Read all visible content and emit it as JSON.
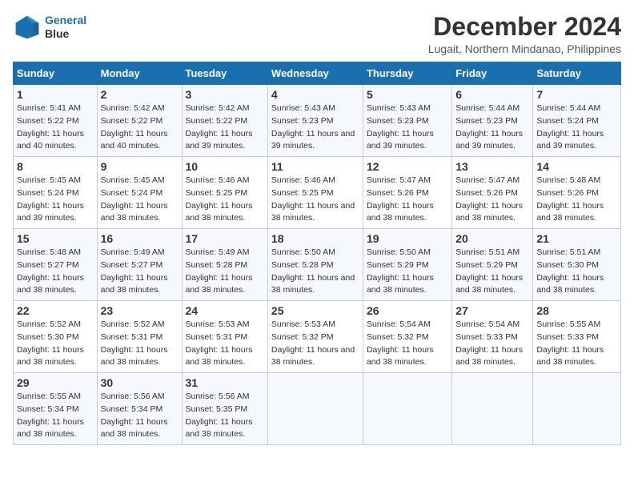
{
  "logo": {
    "line1": "General",
    "line2": "Blue"
  },
  "title": "December 2024",
  "subtitle": "Lugait, Northern Mindanao, Philippines",
  "weekdays": [
    "Sunday",
    "Monday",
    "Tuesday",
    "Wednesday",
    "Thursday",
    "Friday",
    "Saturday"
  ],
  "weeks": [
    [
      {
        "day": "1",
        "sunrise": "5:41 AM",
        "sunset": "5:22 PM",
        "daylight": "11 hours and 40 minutes."
      },
      {
        "day": "2",
        "sunrise": "5:42 AM",
        "sunset": "5:22 PM",
        "daylight": "11 hours and 40 minutes."
      },
      {
        "day": "3",
        "sunrise": "5:42 AM",
        "sunset": "5:22 PM",
        "daylight": "11 hours and 39 minutes."
      },
      {
        "day": "4",
        "sunrise": "5:43 AM",
        "sunset": "5:23 PM",
        "daylight": "11 hours and 39 minutes."
      },
      {
        "day": "5",
        "sunrise": "5:43 AM",
        "sunset": "5:23 PM",
        "daylight": "11 hours and 39 minutes."
      },
      {
        "day": "6",
        "sunrise": "5:44 AM",
        "sunset": "5:23 PM",
        "daylight": "11 hours and 39 minutes."
      },
      {
        "day": "7",
        "sunrise": "5:44 AM",
        "sunset": "5:24 PM",
        "daylight": "11 hours and 39 minutes."
      }
    ],
    [
      {
        "day": "8",
        "sunrise": "5:45 AM",
        "sunset": "5:24 PM",
        "daylight": "11 hours and 39 minutes."
      },
      {
        "day": "9",
        "sunrise": "5:45 AM",
        "sunset": "5:24 PM",
        "daylight": "11 hours and 38 minutes."
      },
      {
        "day": "10",
        "sunrise": "5:46 AM",
        "sunset": "5:25 PM",
        "daylight": "11 hours and 38 minutes."
      },
      {
        "day": "11",
        "sunrise": "5:46 AM",
        "sunset": "5:25 PM",
        "daylight": "11 hours and 38 minutes."
      },
      {
        "day": "12",
        "sunrise": "5:47 AM",
        "sunset": "5:26 PM",
        "daylight": "11 hours and 38 minutes."
      },
      {
        "day": "13",
        "sunrise": "5:47 AM",
        "sunset": "5:26 PM",
        "daylight": "11 hours and 38 minutes."
      },
      {
        "day": "14",
        "sunrise": "5:48 AM",
        "sunset": "5:26 PM",
        "daylight": "11 hours and 38 minutes."
      }
    ],
    [
      {
        "day": "15",
        "sunrise": "5:48 AM",
        "sunset": "5:27 PM",
        "daylight": "11 hours and 38 minutes."
      },
      {
        "day": "16",
        "sunrise": "5:49 AM",
        "sunset": "5:27 PM",
        "daylight": "11 hours and 38 minutes."
      },
      {
        "day": "17",
        "sunrise": "5:49 AM",
        "sunset": "5:28 PM",
        "daylight": "11 hours and 38 minutes."
      },
      {
        "day": "18",
        "sunrise": "5:50 AM",
        "sunset": "5:28 PM",
        "daylight": "11 hours and 38 minutes."
      },
      {
        "day": "19",
        "sunrise": "5:50 AM",
        "sunset": "5:29 PM",
        "daylight": "11 hours and 38 minutes."
      },
      {
        "day": "20",
        "sunrise": "5:51 AM",
        "sunset": "5:29 PM",
        "daylight": "11 hours and 38 minutes."
      },
      {
        "day": "21",
        "sunrise": "5:51 AM",
        "sunset": "5:30 PM",
        "daylight": "11 hours and 38 minutes."
      }
    ],
    [
      {
        "day": "22",
        "sunrise": "5:52 AM",
        "sunset": "5:30 PM",
        "daylight": "11 hours and 38 minutes."
      },
      {
        "day": "23",
        "sunrise": "5:52 AM",
        "sunset": "5:31 PM",
        "daylight": "11 hours and 38 minutes."
      },
      {
        "day": "24",
        "sunrise": "5:53 AM",
        "sunset": "5:31 PM",
        "daylight": "11 hours and 38 minutes."
      },
      {
        "day": "25",
        "sunrise": "5:53 AM",
        "sunset": "5:32 PM",
        "daylight": "11 hours and 38 minutes."
      },
      {
        "day": "26",
        "sunrise": "5:54 AM",
        "sunset": "5:32 PM",
        "daylight": "11 hours and 38 minutes."
      },
      {
        "day": "27",
        "sunrise": "5:54 AM",
        "sunset": "5:33 PM",
        "daylight": "11 hours and 38 minutes."
      },
      {
        "day": "28",
        "sunrise": "5:55 AM",
        "sunset": "5:33 PM",
        "daylight": "11 hours and 38 minutes."
      }
    ],
    [
      {
        "day": "29",
        "sunrise": "5:55 AM",
        "sunset": "5:34 PM",
        "daylight": "11 hours and 38 minutes."
      },
      {
        "day": "30",
        "sunrise": "5:56 AM",
        "sunset": "5:34 PM",
        "daylight": "11 hours and 38 minutes."
      },
      {
        "day": "31",
        "sunrise": "5:56 AM",
        "sunset": "5:35 PM",
        "daylight": "11 hours and 38 minutes."
      },
      null,
      null,
      null,
      null
    ]
  ]
}
